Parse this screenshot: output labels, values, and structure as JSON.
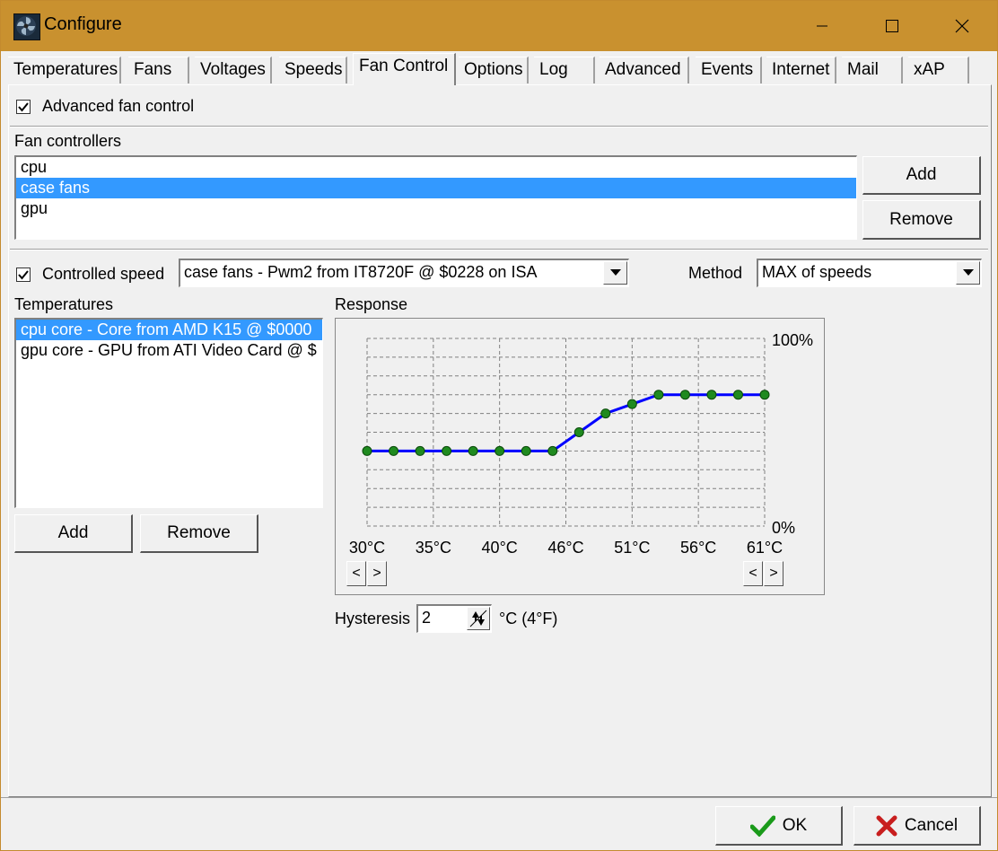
{
  "window": {
    "title": "Configure",
    "minimize_glyph": "—",
    "maximize_glyph": "☐",
    "close_glyph": "✕"
  },
  "tabs": [
    {
      "label": "Temperatures"
    },
    {
      "label": "Fans"
    },
    {
      "label": "Voltages"
    },
    {
      "label": "Speeds"
    },
    {
      "label": "Fan Control",
      "active": true
    },
    {
      "label": "Options"
    },
    {
      "label": "Log"
    },
    {
      "label": "Advanced"
    },
    {
      "label": "Events"
    },
    {
      "label": "Internet"
    },
    {
      "label": "Mail"
    },
    {
      "label": "xAP"
    }
  ],
  "advanced_fan_control": {
    "label": "Advanced fan control",
    "checked": true
  },
  "fan_controllers": {
    "label": "Fan controllers",
    "items": [
      "cpu",
      "case fans",
      "gpu"
    ],
    "selected_index": 1,
    "add_label": "Add",
    "remove_label": "Remove"
  },
  "controlled_speed": {
    "label": "Controlled speed",
    "checked": true,
    "value": "case fans - Pwm2 from IT8720F @ $0228 on ISA"
  },
  "method": {
    "label": "Method",
    "value": "MAX of speeds"
  },
  "temperatures": {
    "label": "Temperatures",
    "items": [
      "cpu core - Core from AMD K15 @ $0000",
      "gpu core - GPU from ATI Video Card @ $"
    ],
    "selected_index": 0,
    "add_label": "Add",
    "remove_label": "Remove"
  },
  "response": {
    "label": "Response",
    "left_nav_prev": "<",
    "left_nav_next": ">",
    "right_nav_prev": "<",
    "right_nav_next": ">"
  },
  "hysteresis": {
    "label": "Hysteresis",
    "value": "2",
    "unit": "°C (4°F)"
  },
  "footer": {
    "ok_label": "OK",
    "cancel_label": "Cancel"
  },
  "colors": {
    "title_bar": "#c9912f",
    "selection": "#3399ff",
    "curve": "#0000ff",
    "points": "#1f8a1f"
  },
  "chart_data": {
    "type": "line",
    "x": [
      "30°C",
      "32°C",
      "34°C",
      "36°C",
      "38°C",
      "40°C",
      "42°C",
      "44°C",
      "46°C",
      "48°C",
      "50°C",
      "52°C",
      "54°C",
      "56°C",
      "58°C",
      "60°C"
    ],
    "series": [
      {
        "values": [
          40,
          40,
          40,
          40,
          40,
          40,
          40,
          40,
          50,
          60,
          65,
          70,
          70,
          70,
          70,
          70
        ]
      }
    ],
    "x_tick_labels": [
      "30°C",
      "35°C",
      "40°C",
      "46°C",
      "51°C",
      "56°C",
      "61°C"
    ],
    "y_max_label": "100%",
    "y_min_label": "0%",
    "ylim": [
      0,
      100
    ],
    "grid": true
  }
}
